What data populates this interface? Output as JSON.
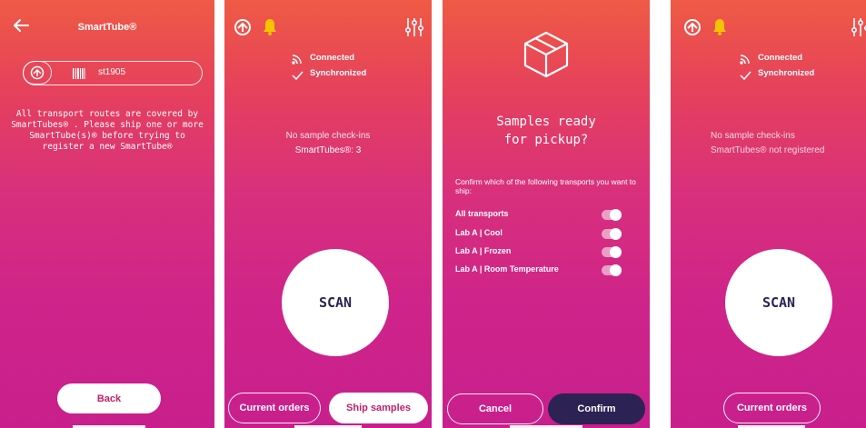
{
  "screen1": {
    "title": "SmartTube®",
    "field_value": "st1905",
    "message": "All transport routes are covered by SmartTubes® . Please ship one or more SmartTube(s)® before trying to register a new SmartTube®",
    "back_label": "Back"
  },
  "screen2": {
    "status_connected": "Connected",
    "status_synchronized": "Synchronized",
    "info_line1": "No sample check-ins",
    "info_line2": "SmartTubes®: 3",
    "scan_label": "SCAN",
    "current_orders_label": "Current orders",
    "ship_samples_label": "Ship samples"
  },
  "screen3": {
    "heading_line1": "Samples ready",
    "heading_line2": "for pickup?",
    "instructions": "Confirm which of the following transports you want to ship:",
    "transports": [
      {
        "label": "All transports",
        "enabled": true
      },
      {
        "label": "Lab A | Cool",
        "enabled": true
      },
      {
        "label": "Lab A | Frozen",
        "enabled": true
      },
      {
        "label": "Lab A | Room Temperature",
        "enabled": true
      }
    ],
    "cancel_label": "Cancel",
    "confirm_label": "Confirm"
  },
  "screen4": {
    "status_connected": "Connected",
    "status_synchronized": "Synchronized",
    "info_line1": "No sample check-ins",
    "info_line2": "SmartTubes® not registered",
    "scan_label": "SCAN",
    "current_orders_label": "Current orders"
  },
  "colors": {
    "gradient_top": "#ef5a44",
    "gradient_bottom": "#c81f8d",
    "bell": "#f5c400",
    "dark_button": "#2c2254"
  },
  "icons": [
    "back-arrow-icon",
    "barcode-icon",
    "upload-logo-icon",
    "bell-icon",
    "sliders-icon",
    "wifi-icon",
    "checkmark-icon",
    "box-icon"
  ]
}
